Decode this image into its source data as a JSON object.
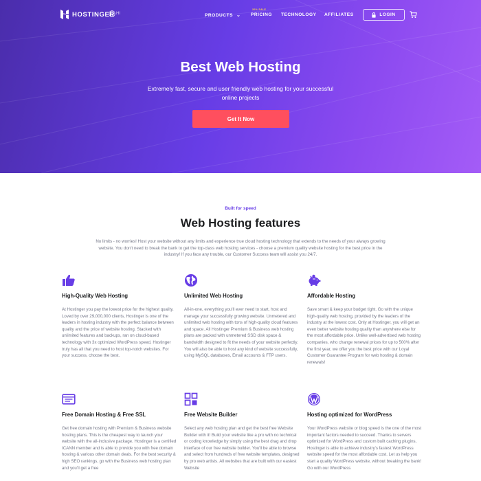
{
  "header": {
    "logo_text": "HOSTINGER",
    "language": "HI",
    "nav": {
      "products": "PRODUCTS",
      "pricing": "PRICING",
      "sale_tag": "20% SALE",
      "technology": "TECHNOLOGY",
      "affiliates": "AFFILIATES",
      "login": "LOGIN"
    }
  },
  "hero": {
    "title": "Best Web Hosting",
    "subtitle": "Extremely fast, secure and user friendly web hosting for your successful online projects",
    "cta": "Get It Now"
  },
  "features_section": {
    "kicker": "Built for speed",
    "title": "Web Hosting features",
    "description": "No limits - no worries! Host your website without any limits and experience true cloud hosting technology that extends to the needs of your always growing website. You don't need to break the bank to get the top-class web hosting services - choose a premium quality website hosting for the best price in the industry! If you face any trouble, our Customer Success team will assist you 24/7.",
    "items": [
      {
        "icon": "thumbs-up-icon",
        "title": "High-Quality Web Hosting",
        "text": "At Hostinger you pay the lowest price for the highest quality. Loved by over 29,000,000 clients, Hostinger is one of the leaders in hosting industry with the perfect balance between quality and the price of website hosting. Stacked with unlimited features and backups, ran on cloud-based technology with 3x optimized WordPress speed, Hostinger truly has all that you need to host top-notch websites. For your success, choose the best."
      },
      {
        "icon": "globe-icon",
        "title": "Unlimited Web Hosting",
        "text": "All-in-one, everything you'll ever need to start, host and manage your successfully growing website. Unmetered and unlimited web hosting with tons of high-quality cloud features and space. All Hostinger Premium & Business web hosting plans are packed with unmetered SSD disk space & bandwidth designed to fit the needs of your website perfectly. You will also be able to host any kind of website successfully, using MySQL databases, Email accounts & FTP users."
      },
      {
        "icon": "piggy-bank-icon",
        "title": "Affordable Hosting",
        "text": "Save smart & keep your budget tight. Go with the unique high-quality web hosting, provided by the leaders of the industry at the lowest cost. Only at Hostinger, you will get an even better website hosting quality than anywhere else for the most affordable price. Unlike well-advertised web hosting companies, who change renewal prices for up to 500% after the first year, we offer you the best price with our Loyal Customer Guarantee Program for web hosting & domain renewals!"
      },
      {
        "icon": "domain-card-icon",
        "title": "Free Domain Hosting & Free SSL",
        "text": "Get free domain hosting with Premium & Business website hosting plans. This is the cheapest way to launch your website with the all-inclusive package. Hostinger is a certified ICANN member and is able to provide you with free domain hosting & various other domain deals. For the best security & high SEO rankings, go with the Business web hosting plan and you'll get a free"
      },
      {
        "icon": "website-builder-icon",
        "title": "Free Website Builder",
        "text": "Select any web hosting plan and get the best free Website Builder with it! Build your website like a pro with no technical or coding knowledge by simply using the best drag and drop interface of our free website builder. You'll be able to browse and select from hundreds of free website templates, designed by pro web artists. All websites that are built with our easiest Website"
      },
      {
        "icon": "wordpress-icon",
        "title": "Hosting optimized for WordPress",
        "text": "Your WordPress website or blog speed is the one of the most important factors needed to succeed. Thanks to servers optimized for WordPress and custom built caching plugins, Hostinger is able to achieve industry's fastest WordPress website speed for the most affordable cost. Let us help you start a quality WordPress website, without breaking the bank! Go with our WordPress"
      }
    ]
  },
  "colors": {
    "brand_purple": "#673de6",
    "cta_red": "#ff4f5e",
    "sale_yellow": "#ffd24d"
  }
}
